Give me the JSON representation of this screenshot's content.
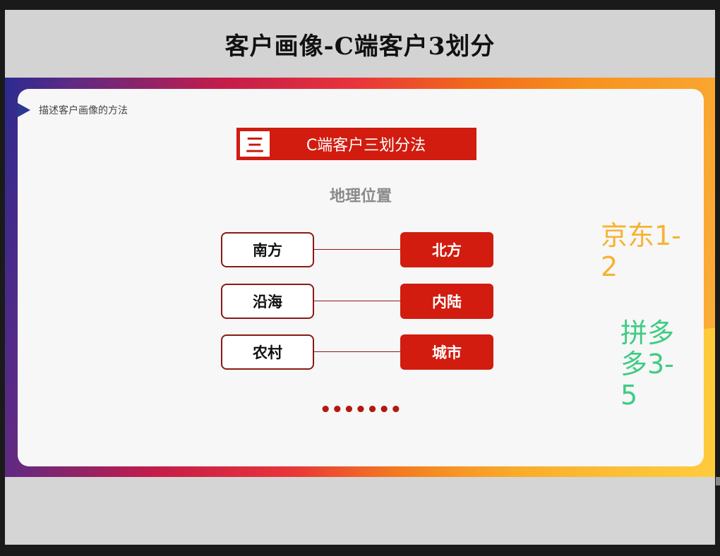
{
  "slide": {
    "title": "客户画像-C端客户3划分",
    "caption": "描述客户画像的方法",
    "method_number": "三",
    "method_label": "C端客户三划分法",
    "section_heading": "地理位置",
    "pairs": [
      {
        "left": "南方",
        "right": "北方"
      },
      {
        "left": "沿海",
        "right": "内陆"
      },
      {
        "left": "农村",
        "right": "城市"
      }
    ],
    "ellipsis": "•••••••"
  },
  "annotations": {
    "jd": "京东1-2",
    "pdd": "拼多多3-5",
    "jd_color": "#f6b333",
    "pdd_color": "#3fcc84"
  },
  "colors": {
    "accent_red": "#d11c0f",
    "outline": "#8a1a12"
  }
}
